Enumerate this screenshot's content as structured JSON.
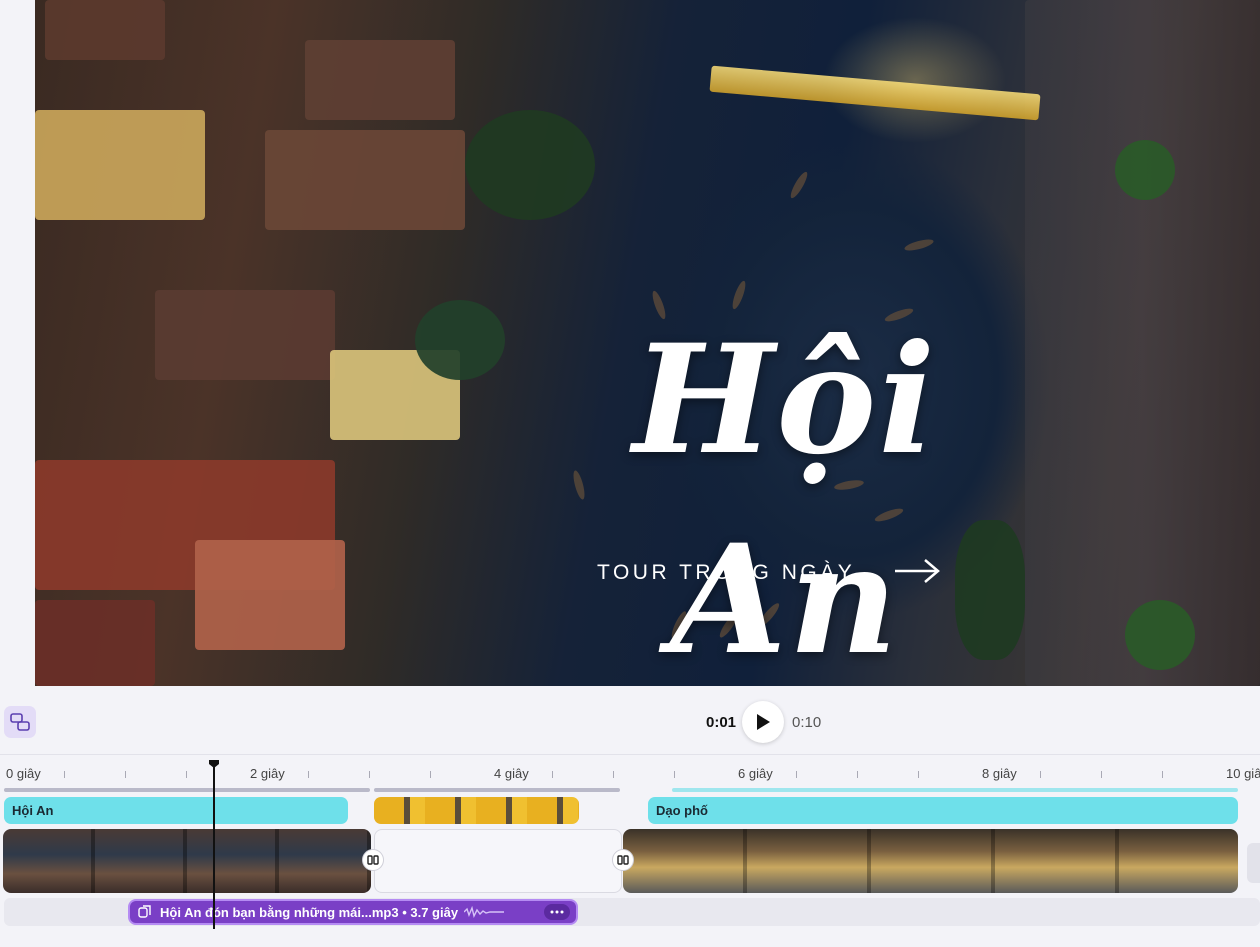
{
  "preview": {
    "title": "Hội An",
    "subtitle": "TOUR TRONG NGÀY",
    "arrow_icon": "arrow-right-icon"
  },
  "controls": {
    "layout_icon": "layout-swap-icon",
    "current_time": "0:01",
    "total_time": "0:10",
    "play_icon": "play-icon"
  },
  "timeline": {
    "ruler": [
      "0 giây",
      "2 giây",
      "4 giây",
      "6 giây",
      "8 giây",
      "10 giâ"
    ],
    "text_clips": [
      {
        "label": "Hội An"
      },
      {
        "label": "Dạo phố"
      }
    ],
    "audio": {
      "label": "Hội An đón bạn bằng những mái...mp3 • 3.7 giây",
      "icon": "audio-clip-icon",
      "more_icon": "more-dots-icon"
    },
    "playhead_time": "0:01"
  },
  "colors": {
    "text_clip": "#6ee0ea",
    "audio_clip": "#7a3fc6",
    "accent": "#b58bf3"
  }
}
